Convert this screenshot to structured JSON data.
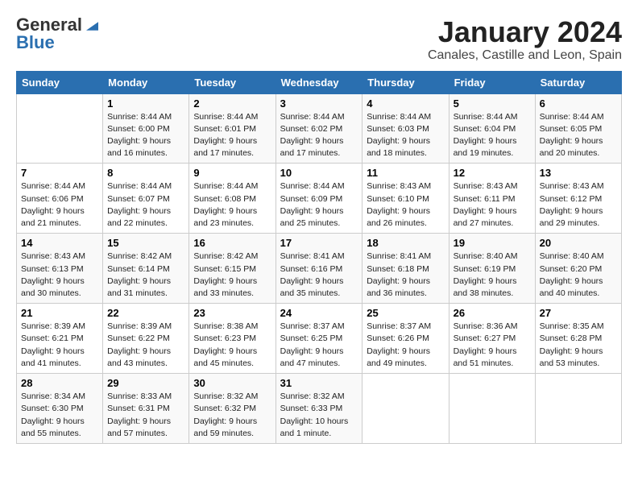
{
  "logo": {
    "general": "General",
    "blue": "Blue"
  },
  "title": "January 2024",
  "location": "Canales, Castille and Leon, Spain",
  "days_of_week": [
    "Sunday",
    "Monday",
    "Tuesday",
    "Wednesday",
    "Thursday",
    "Friday",
    "Saturday"
  ],
  "weeks": [
    [
      {
        "day": "",
        "info": ""
      },
      {
        "day": "1",
        "info": "Sunrise: 8:44 AM\nSunset: 6:00 PM\nDaylight: 9 hours\nand 16 minutes."
      },
      {
        "day": "2",
        "info": "Sunrise: 8:44 AM\nSunset: 6:01 PM\nDaylight: 9 hours\nand 17 minutes."
      },
      {
        "day": "3",
        "info": "Sunrise: 8:44 AM\nSunset: 6:02 PM\nDaylight: 9 hours\nand 17 minutes."
      },
      {
        "day": "4",
        "info": "Sunrise: 8:44 AM\nSunset: 6:03 PM\nDaylight: 9 hours\nand 18 minutes."
      },
      {
        "day": "5",
        "info": "Sunrise: 8:44 AM\nSunset: 6:04 PM\nDaylight: 9 hours\nand 19 minutes."
      },
      {
        "day": "6",
        "info": "Sunrise: 8:44 AM\nSunset: 6:05 PM\nDaylight: 9 hours\nand 20 minutes."
      }
    ],
    [
      {
        "day": "7",
        "info": "Sunrise: 8:44 AM\nSunset: 6:06 PM\nDaylight: 9 hours\nand 21 minutes."
      },
      {
        "day": "8",
        "info": "Sunrise: 8:44 AM\nSunset: 6:07 PM\nDaylight: 9 hours\nand 22 minutes."
      },
      {
        "day": "9",
        "info": "Sunrise: 8:44 AM\nSunset: 6:08 PM\nDaylight: 9 hours\nand 23 minutes."
      },
      {
        "day": "10",
        "info": "Sunrise: 8:44 AM\nSunset: 6:09 PM\nDaylight: 9 hours\nand 25 minutes."
      },
      {
        "day": "11",
        "info": "Sunrise: 8:43 AM\nSunset: 6:10 PM\nDaylight: 9 hours\nand 26 minutes."
      },
      {
        "day": "12",
        "info": "Sunrise: 8:43 AM\nSunset: 6:11 PM\nDaylight: 9 hours\nand 27 minutes."
      },
      {
        "day": "13",
        "info": "Sunrise: 8:43 AM\nSunset: 6:12 PM\nDaylight: 9 hours\nand 29 minutes."
      }
    ],
    [
      {
        "day": "14",
        "info": "Sunrise: 8:43 AM\nSunset: 6:13 PM\nDaylight: 9 hours\nand 30 minutes."
      },
      {
        "day": "15",
        "info": "Sunrise: 8:42 AM\nSunset: 6:14 PM\nDaylight: 9 hours\nand 31 minutes."
      },
      {
        "day": "16",
        "info": "Sunrise: 8:42 AM\nSunset: 6:15 PM\nDaylight: 9 hours\nand 33 minutes."
      },
      {
        "day": "17",
        "info": "Sunrise: 8:41 AM\nSunset: 6:16 PM\nDaylight: 9 hours\nand 35 minutes."
      },
      {
        "day": "18",
        "info": "Sunrise: 8:41 AM\nSunset: 6:18 PM\nDaylight: 9 hours\nand 36 minutes."
      },
      {
        "day": "19",
        "info": "Sunrise: 8:40 AM\nSunset: 6:19 PM\nDaylight: 9 hours\nand 38 minutes."
      },
      {
        "day": "20",
        "info": "Sunrise: 8:40 AM\nSunset: 6:20 PM\nDaylight: 9 hours\nand 40 minutes."
      }
    ],
    [
      {
        "day": "21",
        "info": "Sunrise: 8:39 AM\nSunset: 6:21 PM\nDaylight: 9 hours\nand 41 minutes."
      },
      {
        "day": "22",
        "info": "Sunrise: 8:39 AM\nSunset: 6:22 PM\nDaylight: 9 hours\nand 43 minutes."
      },
      {
        "day": "23",
        "info": "Sunrise: 8:38 AM\nSunset: 6:23 PM\nDaylight: 9 hours\nand 45 minutes."
      },
      {
        "day": "24",
        "info": "Sunrise: 8:37 AM\nSunset: 6:25 PM\nDaylight: 9 hours\nand 47 minutes."
      },
      {
        "day": "25",
        "info": "Sunrise: 8:37 AM\nSunset: 6:26 PM\nDaylight: 9 hours\nand 49 minutes."
      },
      {
        "day": "26",
        "info": "Sunrise: 8:36 AM\nSunset: 6:27 PM\nDaylight: 9 hours\nand 51 minutes."
      },
      {
        "day": "27",
        "info": "Sunrise: 8:35 AM\nSunset: 6:28 PM\nDaylight: 9 hours\nand 53 minutes."
      }
    ],
    [
      {
        "day": "28",
        "info": "Sunrise: 8:34 AM\nSunset: 6:30 PM\nDaylight: 9 hours\nand 55 minutes."
      },
      {
        "day": "29",
        "info": "Sunrise: 8:33 AM\nSunset: 6:31 PM\nDaylight: 9 hours\nand 57 minutes."
      },
      {
        "day": "30",
        "info": "Sunrise: 8:32 AM\nSunset: 6:32 PM\nDaylight: 9 hours\nand 59 minutes."
      },
      {
        "day": "31",
        "info": "Sunrise: 8:32 AM\nSunset: 6:33 PM\nDaylight: 10 hours\nand 1 minute."
      },
      {
        "day": "",
        "info": ""
      },
      {
        "day": "",
        "info": ""
      },
      {
        "day": "",
        "info": ""
      }
    ]
  ]
}
